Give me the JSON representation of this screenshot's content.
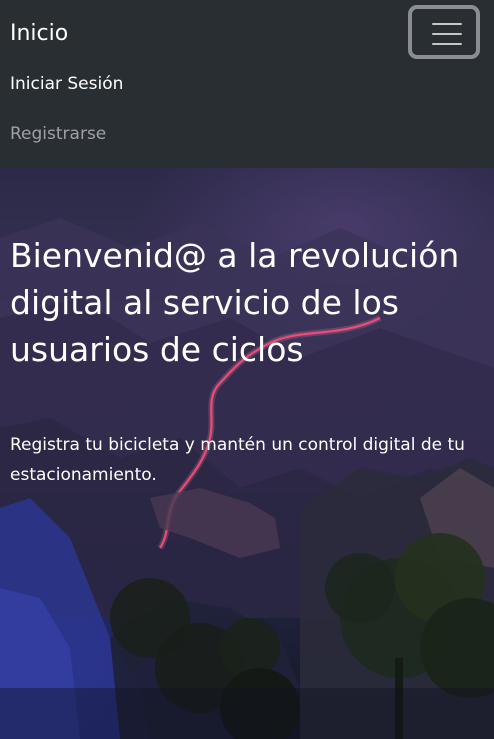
{
  "navbar": {
    "brand": "Inicio",
    "toggle_icon": "hamburger-menu-icon",
    "links": [
      {
        "label": "Iniciar Sesión"
      },
      {
        "label": "Registrarse"
      }
    ],
    "colors": {
      "background": "#292e33",
      "active_link": "#ffffff",
      "muted_link": "#9ea2a6"
    }
  },
  "hero": {
    "title": "Bienvenid@ a la revolución digital al servicio de los usuarios de ciclos",
    "subtitle": "Registra tu bicicleta y mantén un control digital de tu estacionamiento.",
    "background_image": "night mountain landscape with light trail road"
  }
}
